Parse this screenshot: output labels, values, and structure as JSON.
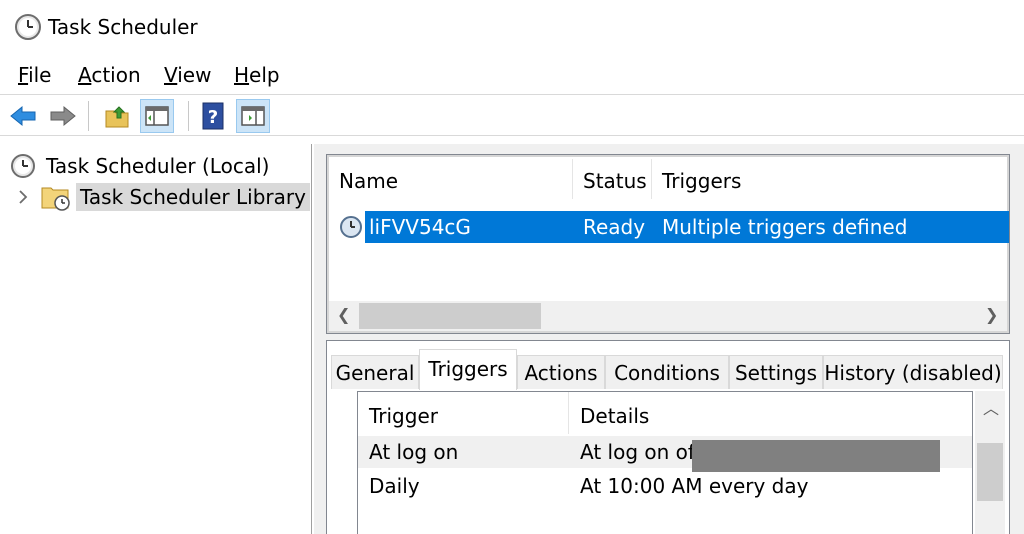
{
  "window": {
    "title": "Task Scheduler",
    "icon": "clock-icon"
  },
  "menu": {
    "items": [
      {
        "label": "File",
        "mnemonic": "F"
      },
      {
        "label": "Action",
        "mnemonic": "A"
      },
      {
        "label": "View",
        "mnemonic": "V"
      },
      {
        "label": "Help",
        "mnemonic": "H"
      }
    ]
  },
  "toolbar": {
    "buttons": [
      "back-arrow-icon",
      "forward-arrow-icon",
      "folder-up-icon",
      "show-hide-console-tree-icon",
      "help-icon",
      "show-hide-action-pane-icon"
    ]
  },
  "tree": {
    "root": "Task Scheduler (Local)",
    "library": "Task Scheduler Library"
  },
  "task_list": {
    "columns": [
      "Name",
      "Status",
      "Triggers"
    ],
    "rows": [
      {
        "name": "liFVV54cG",
        "status": "Ready",
        "triggers": "Multiple triggers defined"
      }
    ]
  },
  "detail": {
    "tabs": [
      "General",
      "Triggers",
      "Actions",
      "Conditions",
      "Settings",
      "History (disabled)"
    ],
    "active_tab": "Triggers",
    "trigger_columns": [
      "Trigger",
      "Details"
    ],
    "triggers": [
      {
        "trigger": "At log on",
        "details": "At log on of"
      },
      {
        "trigger": "Daily",
        "details": "At 10:00 AM every day"
      }
    ]
  },
  "colors": {
    "selection": "#0078d7",
    "toolbar_active": "#cce4f7",
    "background": "#f0f0f0"
  }
}
